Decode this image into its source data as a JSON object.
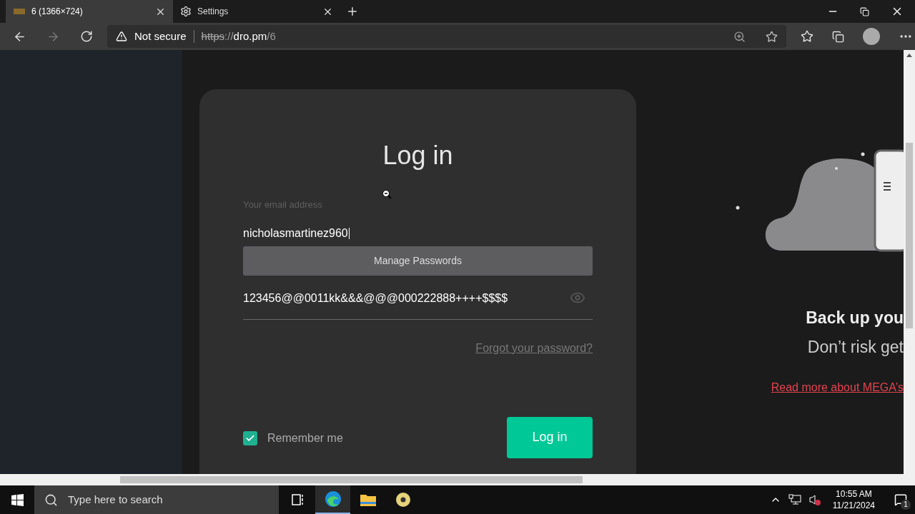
{
  "browser": {
    "tabs": [
      {
        "title": "6 (1366×724)",
        "selected": true
      },
      {
        "title": "Settings",
        "selected": false
      }
    ],
    "address_bar": {
      "security": "Not secure",
      "url": [
        {
          "text": "https",
          "kind": "scheme"
        },
        {
          "text": "://",
          "kind": "dim"
        },
        {
          "text": "dro.pm",
          "kind": "host"
        },
        {
          "text": "/6",
          "kind": "dim"
        }
      ]
    }
  },
  "login": {
    "title": "Log in",
    "email_label": "Your email address",
    "email_value": "nicholasmartinez960",
    "autofill_popup": "Manage Passwords",
    "password_value": "123456@@0011kk&&&@@@000222888++++$$$$",
    "forgot_link": "Forgot your password?",
    "remember": {
      "label": "Remember me",
      "checked": true
    },
    "submit": "Log in"
  },
  "promo": {
    "heading": "Back up you",
    "subheading": "Don’t risk get",
    "link": "Read more about MEGA’s"
  },
  "taskbar": {
    "search_placeholder": "Type here to search",
    "apps": [
      {
        "kind": "taskview",
        "selected": false
      },
      {
        "kind": "edge",
        "selected": true
      },
      {
        "kind": "explorer",
        "selected": false
      },
      {
        "kind": "disc",
        "selected": false
      }
    ],
    "time": "10:55 AM",
    "date": "11/21/2024",
    "notification_count": "1"
  }
}
